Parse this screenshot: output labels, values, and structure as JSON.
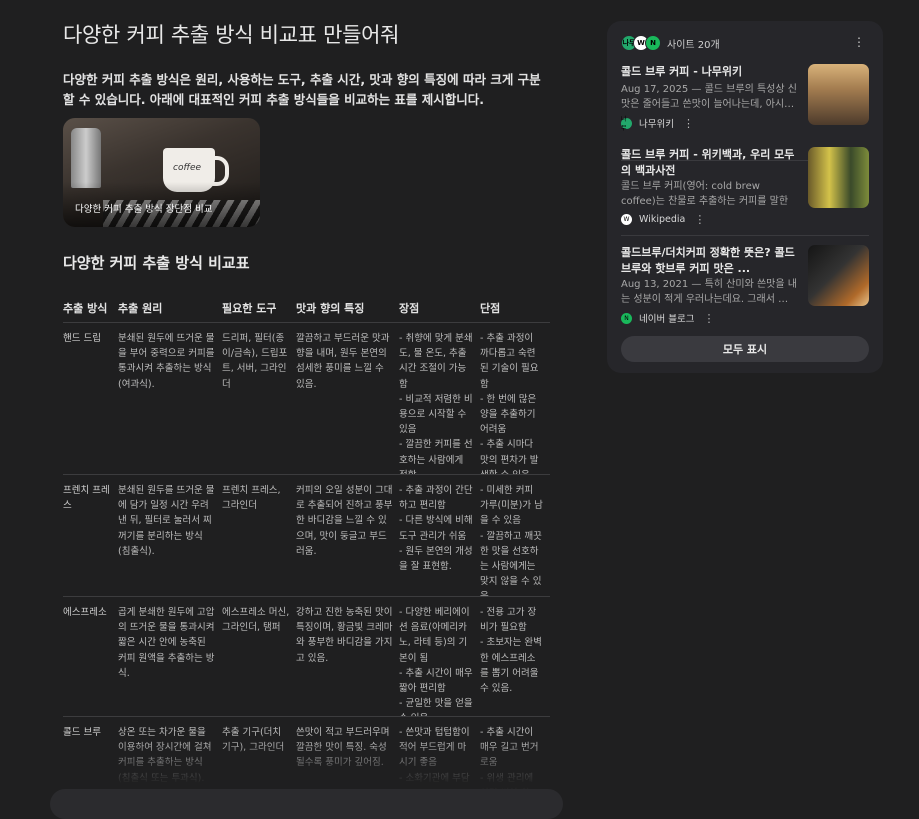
{
  "main": {
    "title": "다양한 커피 추출 방식 비교표 만들어줘",
    "intro": "다양한 커피 추출 방식은 원리, 사용하는 도구, 추출 시간, 맛과 향의 특징에 따라 크게 구분할 수 있습니다. 아래에 대표적인 커피 추출 방식들을 비교하는 표를 제시합니다.",
    "image_caption": "다양한 커피 추출 방식 장단점 비교",
    "image_cup_text": "coffee",
    "subheading": "다양한 커피 추출 방식 비교표",
    "table": {
      "headers": [
        "추출 방식",
        "추출 원리",
        "필요한 도구",
        "맛과 향의 특징",
        "장점",
        "단점"
      ],
      "rows": [
        [
          "핸드 드립",
          "분쇄된 원두에 뜨거운 물을 부어 중력으로 커피를 통과시켜 추출하는 방식 (여과식).",
          "드리퍼, 필터(종이/금속), 드립포트, 서버, 그라인더",
          "깔끔하고 부드러운 맛과 향을 내며, 원두 본연의 섬세한 풍미를 느낄 수 있음.",
          "- 취향에 맞게 분쇄도, 물 온도, 추출 시간 조절이 가능함\n- 비교적 저렴한 비용으로 시작할 수 있음\n- 깔끔한 커피를 선호하는 사람에게 적합.",
          "- 추출 과정이 까다롭고 숙련된 기술이 필요함\n- 한 번에 많은 양을 추출하기 어려움\n- 추출 시마다 맛의 편차가 발생할 수 있음."
        ],
        [
          "프렌치 프레스",
          "분쇄된 원두를 뜨거운 물에 담가 일정 시간 우려낸 뒤, 필터로 눌러서 찌꺼기를 분리하는 방식 (침출식).",
          "프렌치 프레스, 그라인더",
          "커피의 오일 성분이 그대로 추출되어 진하고 풍부한 바디감을 느낄 수 있으며, 맛이 둥글고 부드러움.",
          "- 추출 과정이 간단하고 편리함\n- 다른 방식에 비해 도구 관리가 쉬움\n- 원두 본연의 개성을 잘 표현함.",
          "- 미세한 커피 가루(미분)가 남을 수 있음\n- 깔끔하고 깨끗한 맛을 선호하는 사람에게는 맞지 않을 수 있음."
        ],
        [
          "에스프레소",
          "곱게 분쇄한 원두에 고압의 뜨거운 물을 통과시켜 짧은 시간 안에 농축된 커피 원액을 추출하는 방식.",
          "에스프레소 머신, 그라인더, 탬퍼",
          "강하고 진한 농축된 맛이 특징이며, 황금빛 크레마와 풍부한 바디감을 가지고 있음.",
          "- 다양한 베리에이션 음료(아메리카노, 라테 등)의 기본이 됨\n- 추출 시간이 매우 짧아 편리함\n- 균일한 맛을 얻을 수 있음.",
          "- 전용 고가 장비가 필요함\n- 초보자는 완벽한 에스프레소를 뽑기 어려울 수 있음."
        ],
        [
          "콜드 브루",
          "상온 또는 차가운 물을 이용하여 장시간에 걸쳐 커피를 추출하는 방식 (침출식 또는 투과식).",
          "추출 기구(더치 기구), 그라인더",
          "쓴맛이 적고 부드러우며 깔끔한 맛이 특징. 숙성될수록 풍미가 깊어짐.",
          "- 쓴맛과 텁텁함이 적어 부드럽게 마시기 좋음\n- 소화기관에 부담",
          "- 추출 시간이 매우 길고 번거로움\n- 위생 관리에 신경 써야 함"
        ]
      ]
    }
  },
  "sources": {
    "count_label": "사이트 20개",
    "favicons": [
      "나무",
      "W",
      "N"
    ],
    "items": [
      {
        "title": "콜드 브루 커피 - 나무위키",
        "snippet": "Aug 17, 2025 — 콜드 브루의 특성상 신맛은 줄어들고 쓴맛이 늘어나는데, 아시…",
        "source": "나무위키",
        "icon": "나무"
      },
      {
        "title": "콜드 브루 커피 - 위키백과, 우리 모두의 백과사전",
        "snippet": "콜드 브루 커피(영어: cold brew coffee)는 찬물로 추출하는 커피를 말한다. 뜨…",
        "source": "Wikipedia",
        "icon": "W"
      },
      {
        "title": "콜드브루/더치커피 정확한 뜻은? 콜드브루와 핫브루 커피 맛은 ...",
        "snippet": "Aug 13, 2021 — 특히 산미와 쓴맛을 내는 성분이 적게 우러나는데요. 그래서 …",
        "source": "네이버 블로그",
        "icon": "N"
      }
    ],
    "show_all": "모두 표시"
  },
  "icons": {
    "more": "vertical-ellipsis-icon",
    "item_more": "vertical-ellipsis-icon"
  },
  "colors": {
    "background": "#1f1f20",
    "panel": "#26262a",
    "namu_green": "#22a86b",
    "naver_green": "#19b85b"
  }
}
